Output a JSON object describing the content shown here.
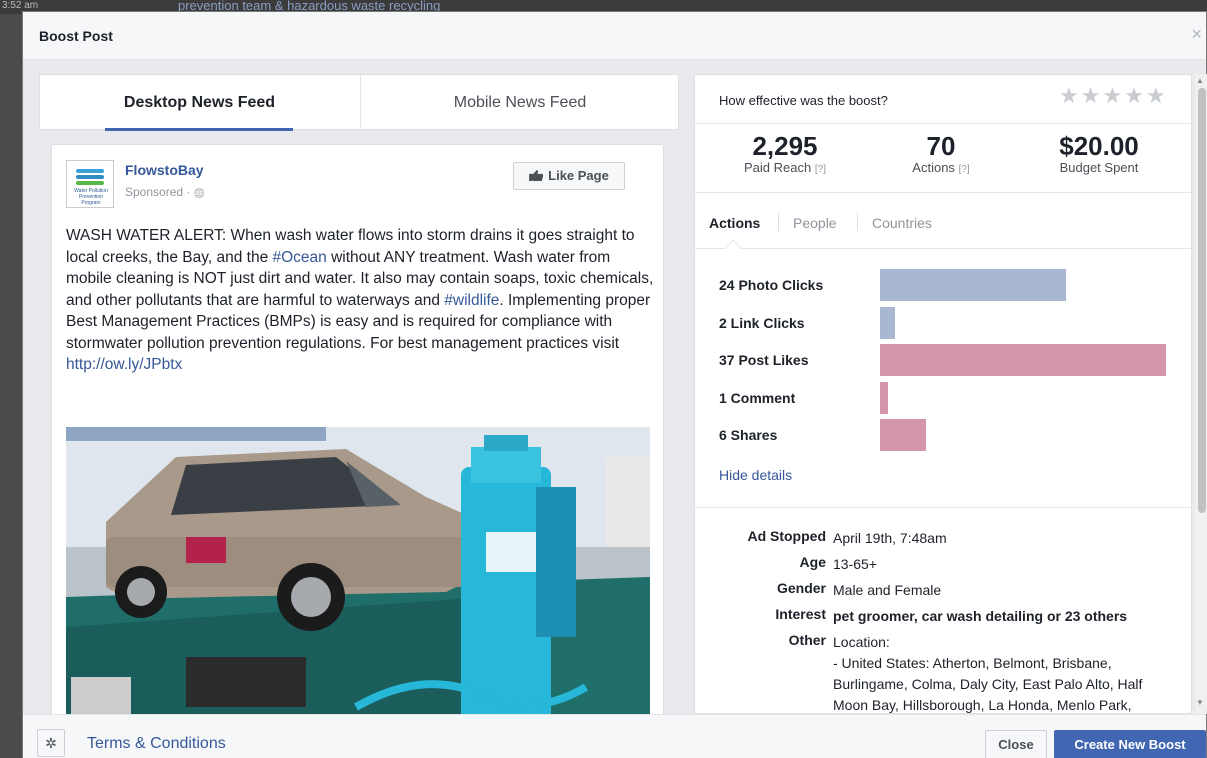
{
  "background": {
    "clock": "3:52 am",
    "text": "prevention team & hazardous waste recycling"
  },
  "dialog": {
    "title": "Boost Post",
    "close_icon": "×"
  },
  "preview": {
    "tabs": [
      {
        "label": "Desktop News Feed",
        "active": true
      },
      {
        "label": "Mobile News Feed",
        "active": false
      }
    ],
    "post": {
      "page_name": "FlowstoBay",
      "logo_text": "Water Pollution Prevention Program",
      "sponsored": "Sponsored · ",
      "globe_icon": "🌐",
      "like_button": "Like Page",
      "text_parts": [
        "WASH WATER ALERT: When wash water flows into storm drains it goes straight to local creeks, the Bay, and the ",
        "#Ocean",
        " without ANY treatment. Wash water from mobile cleaning is NOT just dirt and water. It also may contain soaps, toxic chemicals, and other pollutants that are harmful to waterways and ",
        "#wildlife",
        ". Implementing proper Best Management Practices (BMPs) is easy and is required for compliance with stormwater pollution prevention regulations. For best management practices visit ",
        "http://ow.ly/JPbtx"
      ]
    }
  },
  "results": {
    "question": "How effective was the boost?",
    "stars": "★★★★★",
    "metrics": [
      {
        "value": "2,295",
        "label": "Paid Reach",
        "help": "[?]"
      },
      {
        "value": "70",
        "label": "Actions",
        "help": "[?]"
      },
      {
        "value": "$20.00",
        "label": "Budget Spent",
        "help": ""
      }
    ],
    "tabs": [
      {
        "label": "Actions",
        "active": true
      },
      {
        "label": "People",
        "active": false
      },
      {
        "label": "Countries",
        "active": false
      }
    ],
    "actions": [
      {
        "label": "24 Photo Clicks",
        "value": 24,
        "color": "#a9b7d1"
      },
      {
        "label": "2 Link Clicks",
        "value": 2,
        "color": "#a9b7d1"
      },
      {
        "label": "37 Post Likes",
        "value": 37,
        "color": "#d495aa"
      },
      {
        "label": "1 Comment",
        "value": 1,
        "color": "#d495aa"
      },
      {
        "label": "6 Shares",
        "value": 6,
        "color": "#d495aa"
      }
    ],
    "hide_details": "Hide details",
    "details": [
      {
        "key": "Ad Stopped",
        "value": "April 19th, 7:48am",
        "bold": false
      },
      {
        "key": "Age",
        "value": "13-65+",
        "bold": false
      },
      {
        "key": "Gender",
        "value": "Male and Female",
        "bold": false
      },
      {
        "key": "Interest",
        "value": "pet groomer, car wash detailing or 23 others",
        "bold": true
      },
      {
        "key": "Other",
        "value": "Location:",
        "bold": false
      }
    ],
    "location_lines": [
      "- United States: Atherton, Belmont, Brisbane,",
      "Burlingame, Colma, Daly City, East Palo Alto, Half",
      "Moon Bay, Hillsborough, La Honda, Menlo Park,"
    ]
  },
  "footer": {
    "gear_icon": "✲",
    "terms": "Terms & Conditions",
    "close": "Close",
    "create": "Create New Boost"
  }
}
